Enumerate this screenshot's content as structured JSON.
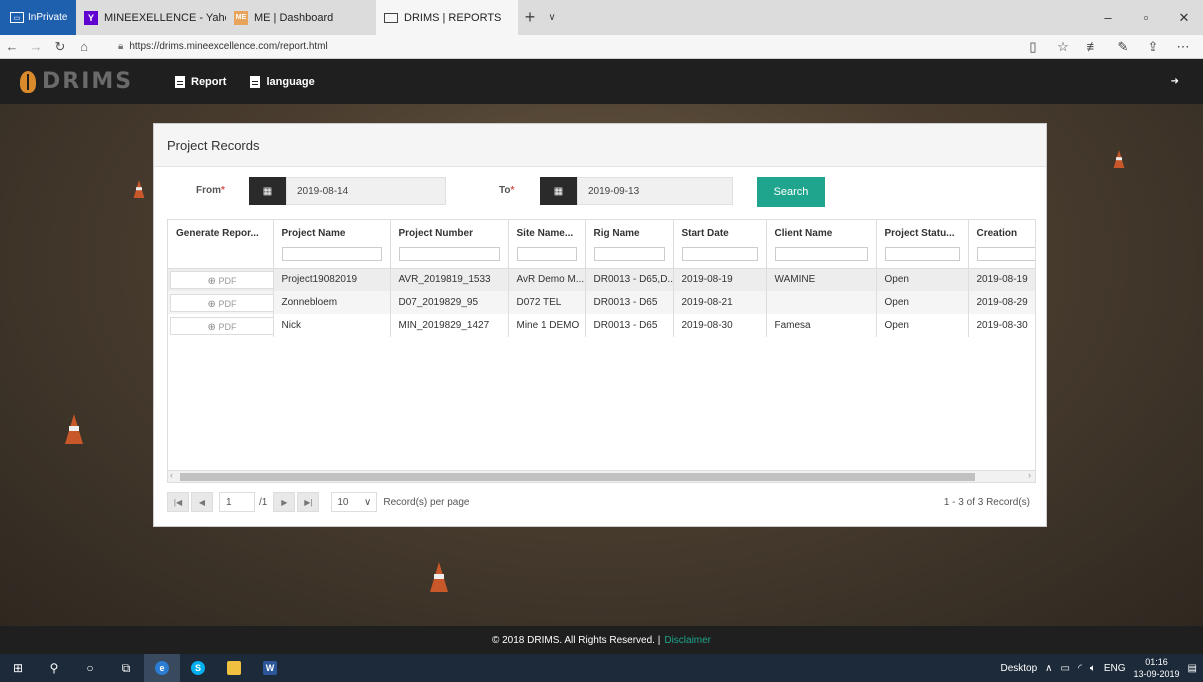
{
  "browser": {
    "inprivate_label": "InPrivate",
    "tabs": [
      {
        "title": "MINEEXELLENCE - Yahoo Se",
        "icon": "yahoo-icon"
      },
      {
        "title": "ME | Dashboard",
        "icon": "me-icon"
      },
      {
        "title": "DRIMS | REPORTS",
        "icon": "page-icon",
        "active": true
      }
    ],
    "url": "https://drims.mineexcellence.com/report.html"
  },
  "app": {
    "logo": "DRIMS",
    "menu": [
      {
        "label": "Report",
        "icon": "document-icon"
      },
      {
        "label": "language",
        "icon": "document-icon"
      }
    ]
  },
  "panel": {
    "title": "Project Records",
    "from_label": "From",
    "to_label": "To",
    "required_mark": "*",
    "from_date": "2019-08-14",
    "to_date": "2019-09-13",
    "search_label": "Search"
  },
  "grid": {
    "columns": [
      "Generate Repor...",
      "Project Name",
      "Project Number",
      "Site Name...",
      "Rig Name",
      "Start Date",
      "Client Name",
      "Project Statu...",
      "Creation"
    ],
    "pdf_label": "PDF",
    "rows": [
      [
        "Project19082019",
        "AVR_2019819_1533",
        "AvR Demo M...",
        "DR0013 - D65,D...",
        "2019-08-19",
        "WAMINE",
        "Open",
        "2019-08-19"
      ],
      [
        "Zonnebloem",
        "D07_2019829_95",
        "D072 TEL",
        "DR0013 - D65",
        "2019-08-21",
        "",
        "Open",
        "2019-08-29"
      ],
      [
        "Nick",
        "MIN_2019829_1427",
        "Mine 1 DEMO",
        "DR0013 - D65",
        "2019-08-30",
        "Famesa",
        "Open",
        "2019-08-30"
      ]
    ]
  },
  "pager": {
    "current_page": "1",
    "total_pages": "/1",
    "page_size": "10",
    "per_page_label": "Record(s) per page",
    "info": "1 - 3 of 3 Record(s)"
  },
  "footer": {
    "text": "© 2018 DRIMS. All Rights Reserved. |",
    "link": "Disclaimer"
  },
  "taskbar": {
    "desktop_label": "Desktop",
    "lang": "ENG",
    "time": "01:16",
    "date": "13-09-2019"
  }
}
